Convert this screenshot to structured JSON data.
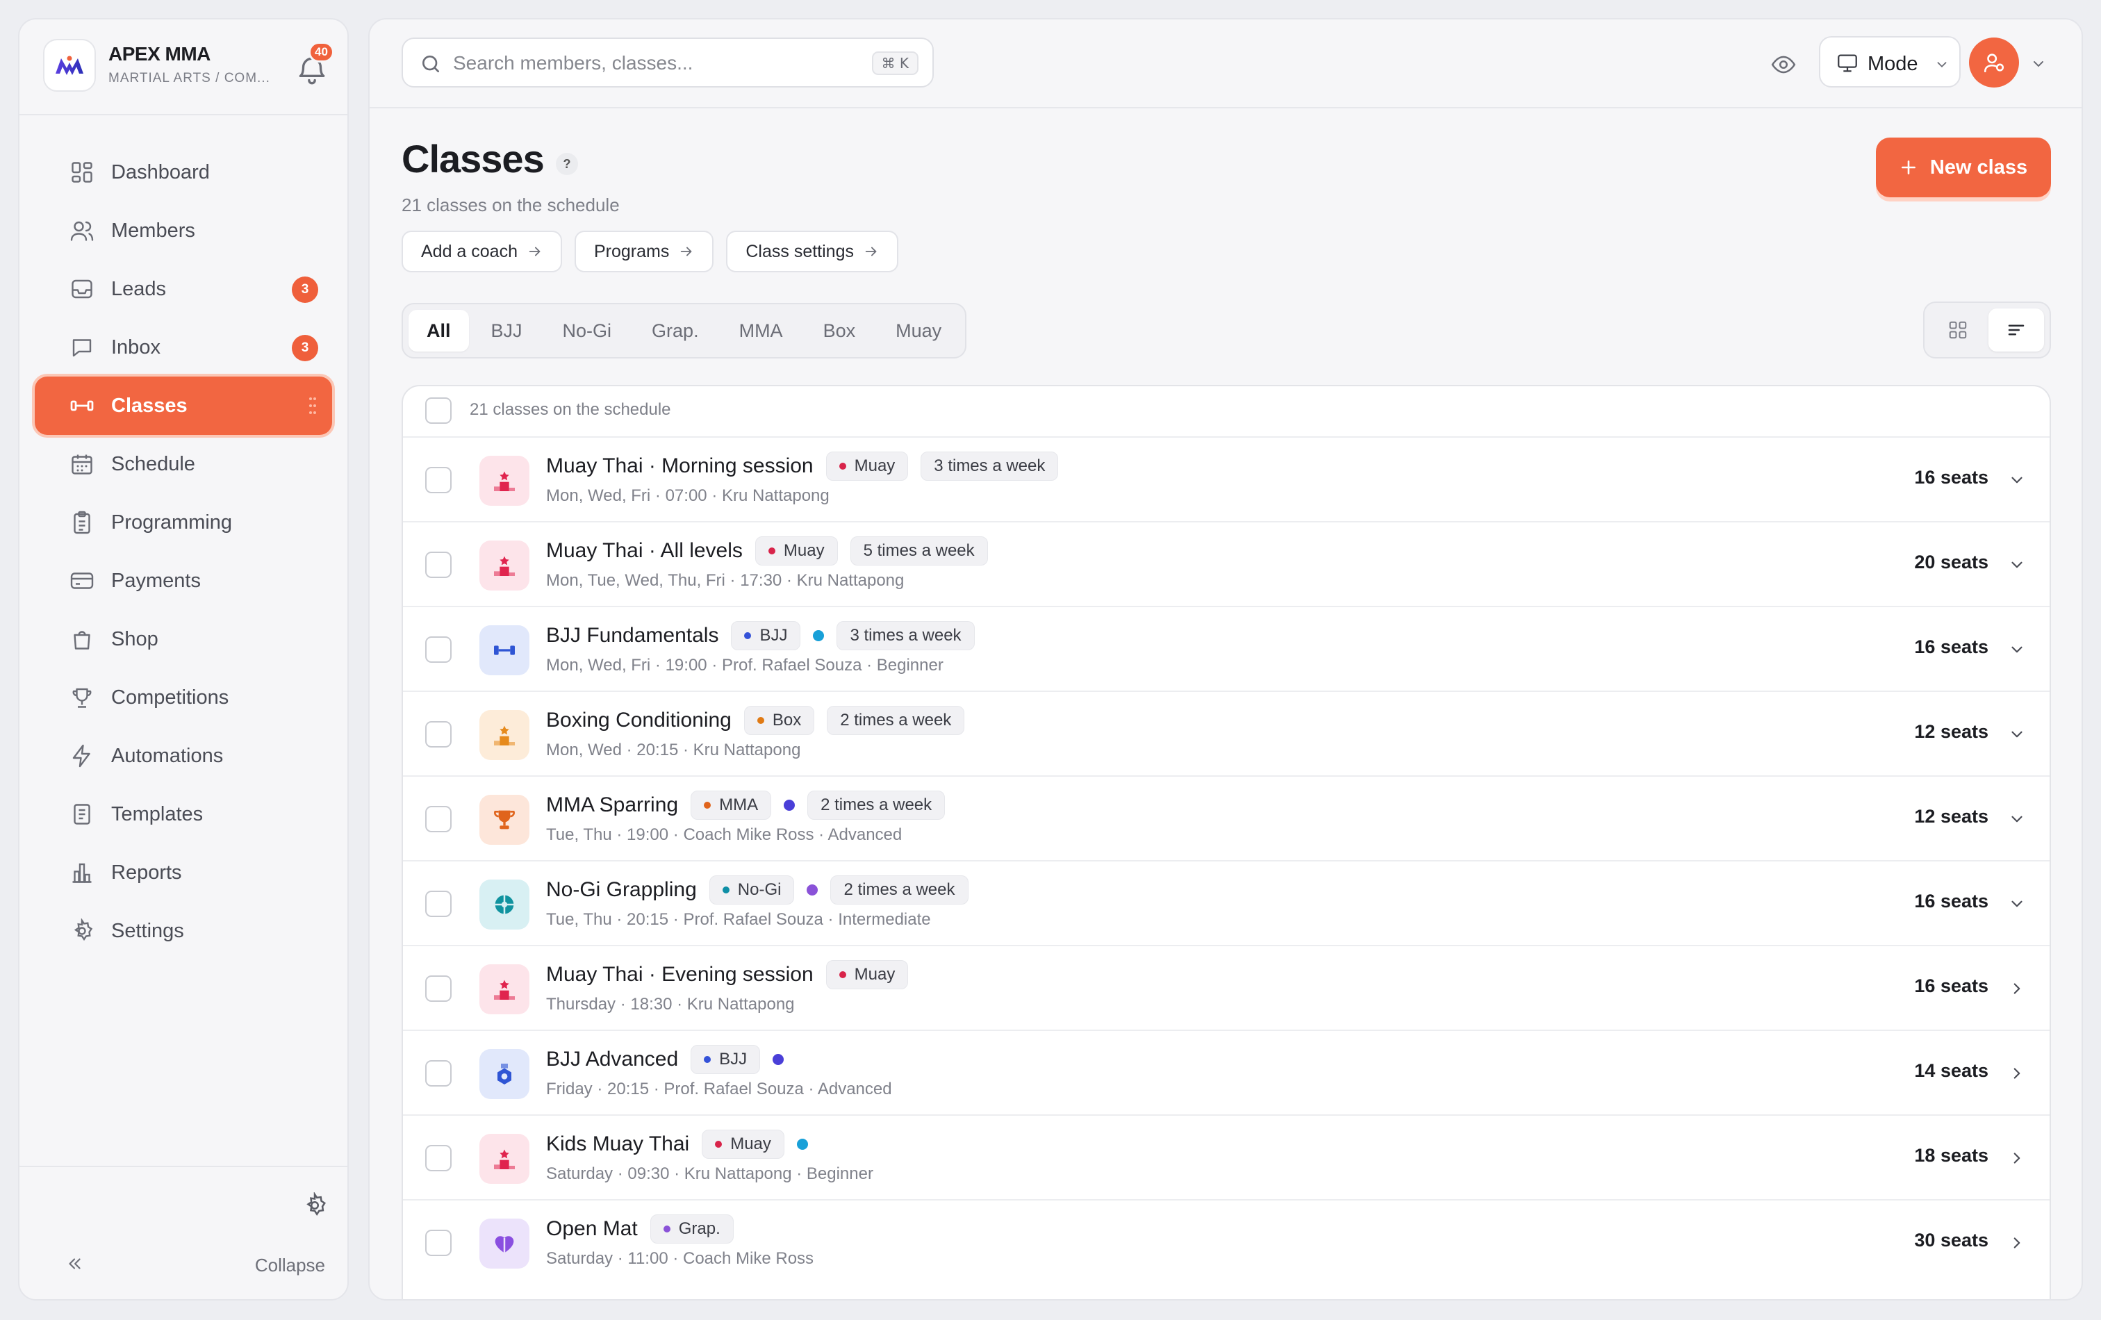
{
  "brand": {
    "name": "APEX MMA",
    "subtitle": "MARTIAL ARTS / COM...",
    "notification_count": "40"
  },
  "sidebar": {
    "items": [
      {
        "label": "Dashboard",
        "icon": "grid-icon",
        "badge": ""
      },
      {
        "label": "Members",
        "icon": "users-icon",
        "badge": ""
      },
      {
        "label": "Leads",
        "icon": "inbox-tray-icon",
        "badge": "3"
      },
      {
        "label": "Inbox",
        "icon": "message-icon",
        "badge": "3"
      },
      {
        "label": "Classes",
        "icon": "dumbbell-icon",
        "badge": "",
        "active": true
      },
      {
        "label": "Schedule",
        "icon": "calendar-icon",
        "badge": ""
      },
      {
        "label": "Programming",
        "icon": "clipboard-icon",
        "badge": ""
      },
      {
        "label": "Payments",
        "icon": "card-icon",
        "badge": ""
      },
      {
        "label": "Shop",
        "icon": "bag-icon",
        "badge": ""
      },
      {
        "label": "Competitions",
        "icon": "trophy-icon",
        "badge": ""
      },
      {
        "label": "Automations",
        "icon": "bolt-icon",
        "badge": ""
      },
      {
        "label": "Templates",
        "icon": "document-icon",
        "badge": ""
      },
      {
        "label": "Reports",
        "icon": "bar-chart-icon",
        "badge": ""
      },
      {
        "label": "Settings",
        "icon": "gear-icon",
        "badge": ""
      }
    ],
    "collapse_label": "Collapse"
  },
  "topbar": {
    "search_placeholder": "Search members, classes...",
    "search_shortcut": "⌘ K",
    "mode_label": "Mode"
  },
  "page": {
    "title": "Classes",
    "help": "?",
    "subtitle": "21 classes on the schedule",
    "quick_links": [
      "Add a coach",
      "Programs",
      "Class settings"
    ],
    "new_button": "New class"
  },
  "filters": [
    "All",
    "BJJ",
    "No-Gi",
    "Grap.",
    "MMA",
    "Box",
    "Muay"
  ],
  "active_filter": "All",
  "table": {
    "header": "21 classes on the schedule",
    "rows": [
      {
        "name": "Muay Thai · Morning session",
        "tag": "Muay",
        "tag_color": "#d8244a",
        "extra_dot": "",
        "freq": "3 times a week",
        "meta": "Mon, Wed, Fri · 07:00 · Kru Nattapong",
        "seats": "16 seats",
        "icon": "podium-icon",
        "icon_bg": "#fde4ea",
        "icon_color": "#e0244e",
        "expand": "down"
      },
      {
        "name": "Muay Thai · All levels",
        "tag": "Muay",
        "tag_color": "#d8244a",
        "extra_dot": "",
        "freq": "5 times a week",
        "meta": "Mon, Tue, Wed, Thu, Fri · 17:30 · Kru Nattapong",
        "seats": "20 seats",
        "icon": "podium-icon",
        "icon_bg": "#fde4ea",
        "icon_color": "#e0244e",
        "expand": "down"
      },
      {
        "name": "BJJ Fundamentals",
        "tag": "BJJ",
        "tag_color": "#3452d8",
        "extra_dot": "#18a0d8",
        "freq": "3 times a week",
        "meta": "Mon, Wed, Fri · 19:00 · Prof. Rafael Souza · Beginner",
        "seats": "16 seats",
        "icon": "dumbbell-icon",
        "icon_bg": "#e1e8fb",
        "icon_color": "#2f55d4",
        "expand": "down"
      },
      {
        "name": "Boxing Conditioning",
        "tag": "Box",
        "tag_color": "#e07a14",
        "extra_dot": "",
        "freq": "2 times a week",
        "meta": "Mon, Wed · 20:15 · Kru Nattapong",
        "seats": "12 seats",
        "icon": "podium-icon",
        "icon_bg": "#fdecd9",
        "icon_color": "#e68a1c",
        "expand": "down"
      },
      {
        "name": "MMA Sparring",
        "tag": "MMA",
        "tag_color": "#e0641c",
        "extra_dot": "#4a3fd8",
        "freq": "2 times a week",
        "meta": "Tue, Thu · 19:00 · Coach Mike Ross · Advanced",
        "seats": "12 seats",
        "icon": "trophy-icon",
        "icon_bg": "#fde6da",
        "icon_color": "#e0641c",
        "expand": "down"
      },
      {
        "name": "No-Gi Grappling",
        "tag": "No-Gi",
        "tag_color": "#0f8fa6",
        "extra_dot": "#8a52d8",
        "freq": "2 times a week",
        "meta": "Tue, Thu · 20:15 · Prof. Rafael Souza · Intermediate",
        "seats": "16 seats",
        "icon": "target-icon",
        "icon_bg": "#d8f0f3",
        "icon_color": "#10939f",
        "expand": "down"
      },
      {
        "name": "Muay Thai · Evening session",
        "tag": "Muay",
        "tag_color": "#d8244a",
        "extra_dot": "",
        "freq": "",
        "meta": "Thursday · 18:30 · Kru Nattapong",
        "seats": "16 seats",
        "icon": "podium-icon",
        "icon_bg": "#fde4ea",
        "icon_color": "#e0244e",
        "expand": "right"
      },
      {
        "name": "BJJ Advanced",
        "tag": "BJJ",
        "tag_color": "#3452d8",
        "extra_dot": "#4a3fd8",
        "freq": "",
        "meta": "Friday · 20:15 · Prof. Rafael Souza · Advanced",
        "seats": "14 seats",
        "icon": "medal-icon",
        "icon_bg": "#e1e8fb",
        "icon_color": "#2f55d4",
        "expand": "right"
      },
      {
        "name": "Kids Muay Thai",
        "tag": "Muay",
        "tag_color": "#d8244a",
        "extra_dot": "#18a0d8",
        "freq": "",
        "meta": "Saturday · 09:30 · Kru Nattapong · Beginner",
        "seats": "18 seats",
        "icon": "podium-icon",
        "icon_bg": "#fde4ea",
        "icon_color": "#e0244e",
        "expand": "right"
      },
      {
        "name": "Open Mat",
        "tag": "Grap.",
        "tag_color": "#8a52d8",
        "extra_dot": "",
        "freq": "",
        "meta": "Saturday · 11:00 · Coach Mike Ross",
        "seats": "30 seats",
        "icon": "heart-icon",
        "icon_bg": "#ece3fb",
        "icon_color": "#8a4fe0",
        "expand": "right"
      }
    ]
  },
  "colors": {
    "accent": "#f26641",
    "badge": "#ef5f3b"
  }
}
